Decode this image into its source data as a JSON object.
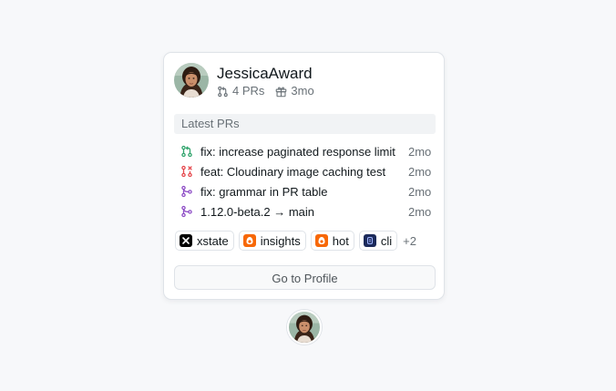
{
  "user": {
    "username": "JessicaAward",
    "pr_count": "4 PRs",
    "account_age": "3mo"
  },
  "latest_prs": {
    "header": "Latest PRs",
    "items": [
      {
        "title": "fix: increase paginated response limit",
        "age": "2mo",
        "status": "open",
        "icon": "git-pull-request-icon",
        "color": "#30a46c"
      },
      {
        "title": "feat: Cloudinary image caching test",
        "age": "2mo",
        "status": "closed",
        "icon": "git-pull-request-closed-icon",
        "color": "#e5484d"
      },
      {
        "title": "fix: grammar in PR table",
        "age": "2mo",
        "status": "merged",
        "icon": "git-merge-icon",
        "color": "#8e4ec6"
      },
      {
        "title": "1.12.0-beta.2 → main",
        "age": "2mo",
        "status": "merged",
        "icon": "git-merge-icon",
        "color": "#8e4ec6"
      }
    ]
  },
  "repos": {
    "items": [
      {
        "name": "xstate",
        "icon": "xstate-logo-icon"
      },
      {
        "name": "insights",
        "icon": "opensauced-logo-icon"
      },
      {
        "name": "hot",
        "icon": "opensauced-logo-icon"
      },
      {
        "name": "cli",
        "icon": "cli-logo-icon"
      }
    ],
    "more": "+2"
  },
  "profile_button": "Go to Profile",
  "colors": {
    "open": "#30a46c",
    "closed": "#e5484d",
    "merged": "#8e4ec6",
    "opensauced_orange": "#f76808",
    "cli_navy": "#1c2a5a"
  }
}
